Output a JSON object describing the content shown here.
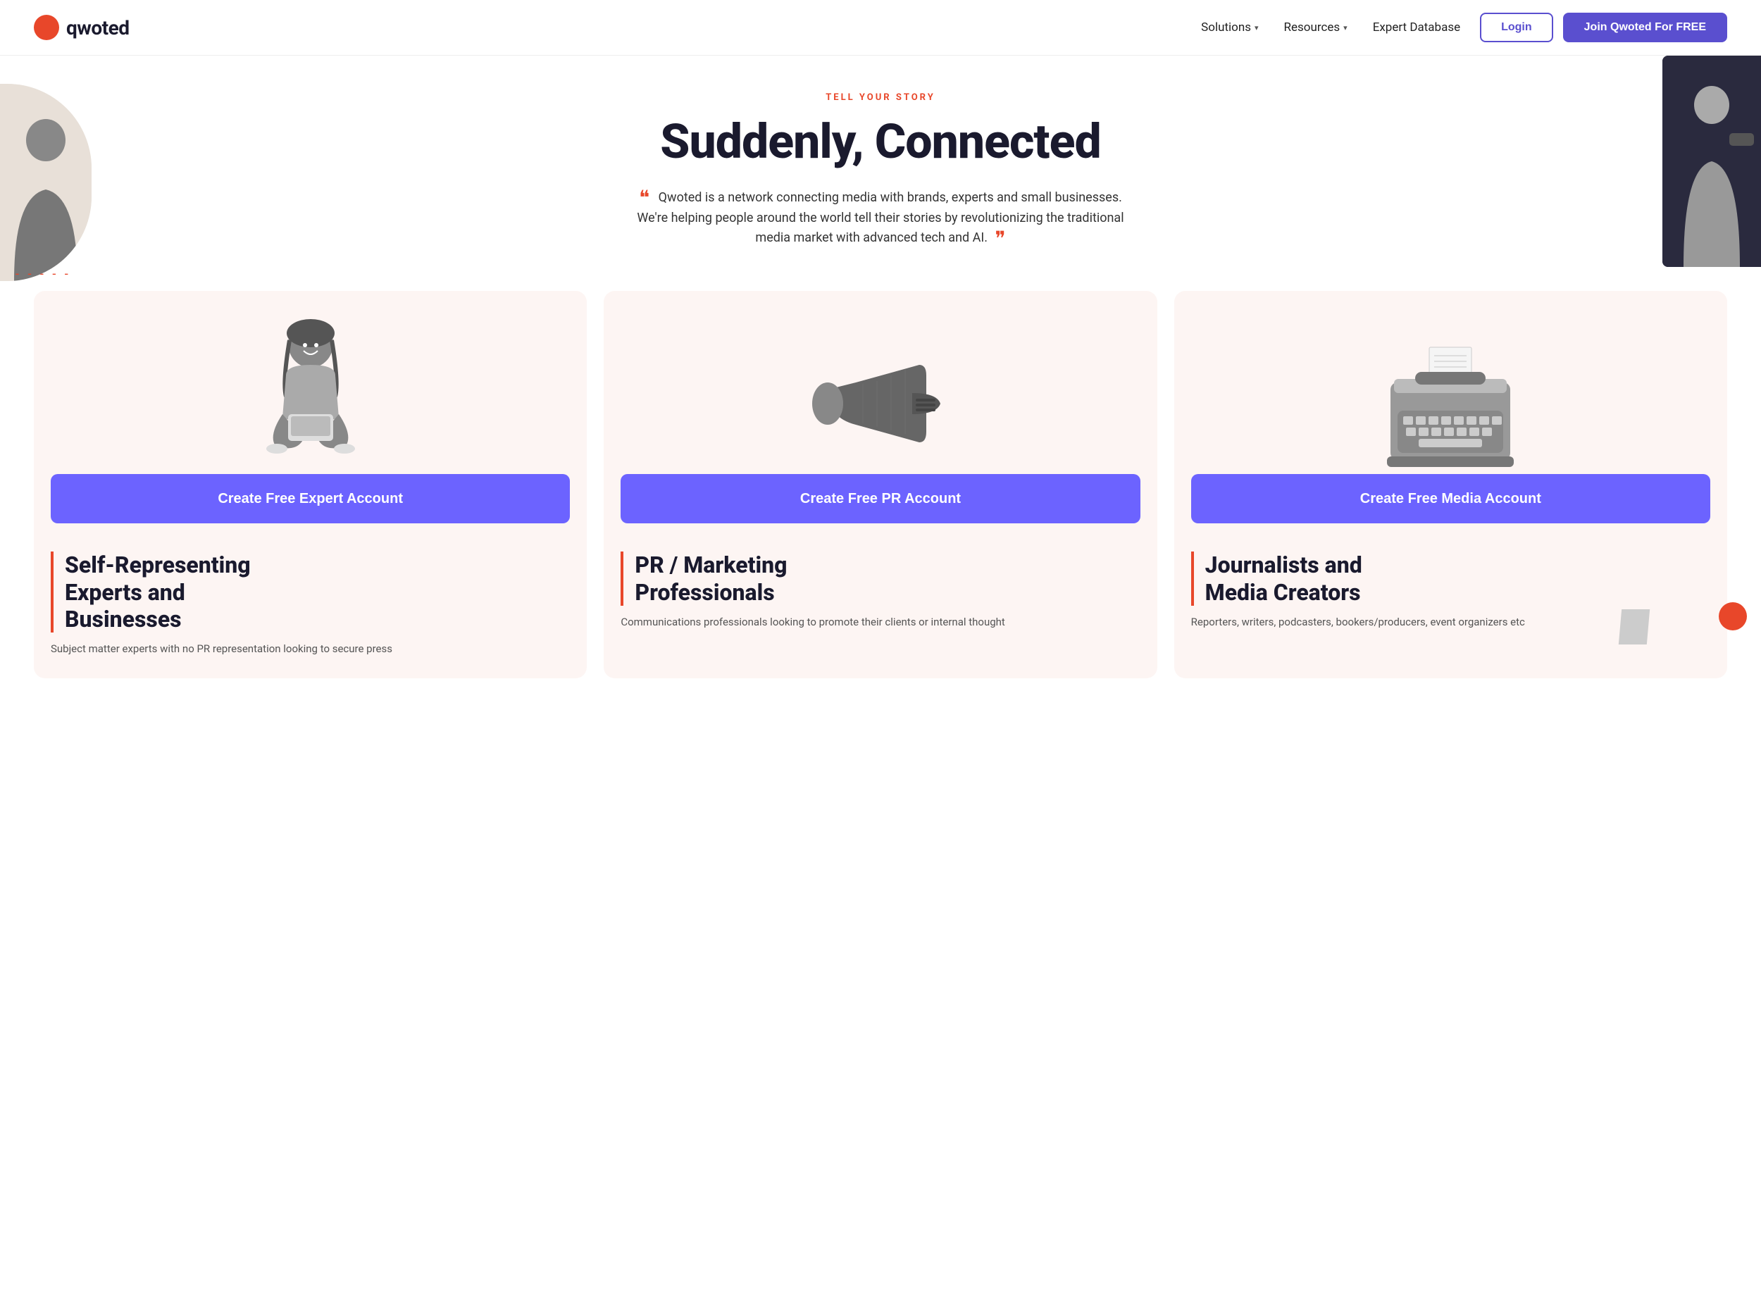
{
  "nav": {
    "logo_text": "qwoted",
    "links": [
      {
        "label": "Solutions",
        "has_dropdown": true
      },
      {
        "label": "Resources",
        "has_dropdown": true
      },
      {
        "label": "Expert Database",
        "has_dropdown": false
      }
    ],
    "login_label": "Login",
    "join_label": "Join Qwoted For FREE"
  },
  "hero": {
    "tagline": "TELL YOUR STORY",
    "title": "Suddenly, Connected",
    "description": "Qwoted is a network connecting media with brands, experts and small businesses. We're helping people around the world tell their stories by revolutionizing the traditional media market with advanced tech and AI."
  },
  "cards": [
    {
      "btn_label": "Create Free Expert\nAccount",
      "category_title": "Self-Representing\nExperts and\nBusinesses",
      "description": "Subject matter experts with no PR representation looking to secure press",
      "illustration": "person"
    },
    {
      "btn_label": "Create Free PR\nAccount",
      "category_title": "PR / Marketing\nProfessionals",
      "description": "Communications professionals looking to promote their clients or internal thought",
      "illustration": "megaphone"
    },
    {
      "btn_label": "Create Free Media\nAccount",
      "category_title": "Journalists and\nMedia Creators",
      "description": "Reporters, writers, podcasters, bookers/producers, event organizers etc",
      "illustration": "typewriter"
    }
  ],
  "colors": {
    "accent": "#e8472a",
    "brand_purple": "#5a4fcf",
    "card_bg": "#fdf5f3",
    "dark": "#1a1a2e"
  }
}
